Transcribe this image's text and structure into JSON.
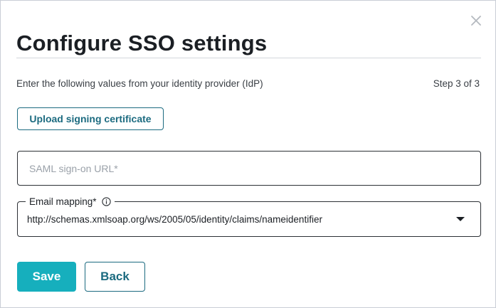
{
  "dialog": {
    "title": "Configure SSO settings",
    "close_icon": "close-icon"
  },
  "instructions": {
    "text": "Enter the following values from your identity provider (IdP)",
    "step": "Step 3 of 3"
  },
  "upload": {
    "label": "Upload signing certificate"
  },
  "saml_url": {
    "placeholder": "SAML sign-on URL*",
    "value": ""
  },
  "email_mapping": {
    "label": "Email mapping*",
    "info_icon": "info-icon",
    "selected": "http://schemas.xmlsoap.org/ws/2005/05/identity/claims/nameidentifier",
    "caret_icon": "caret-down-icon"
  },
  "actions": {
    "save_label": "Save",
    "back_label": "Back"
  },
  "colors": {
    "primary": "#16afbd",
    "secondary_text": "#1c6b80",
    "border": "#2c3035"
  }
}
